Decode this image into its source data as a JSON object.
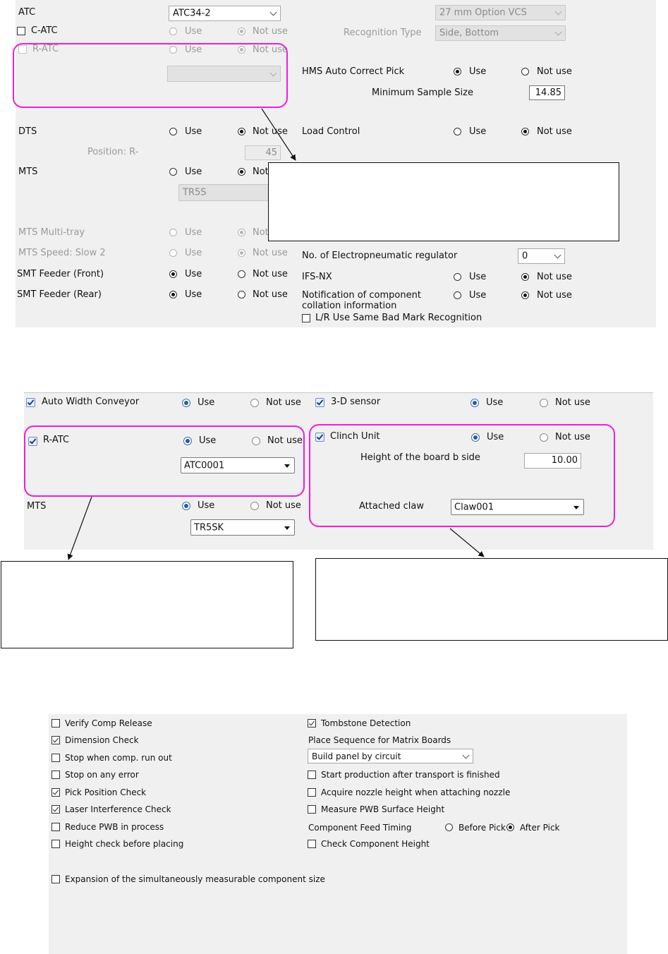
{
  "p1": {
    "atc": {
      "label": "ATC",
      "value": "ATC34-2"
    },
    "option_vcs": "27 mm Option VCS",
    "c_atc": {
      "label": "C-ATC",
      "use": "Use",
      "notuse": "Not use"
    },
    "recognition": {
      "label": "Recognition Type",
      "value": "Side, Bottom"
    },
    "r_atc": {
      "label": "R-ATC",
      "use": "Use",
      "notuse": "Not use"
    },
    "hms": {
      "label": "HMS Auto Correct Pick",
      "use": "Use",
      "notuse": "Not use"
    },
    "min_sample": {
      "label": "Minimum Sample Size",
      "value": "14.85"
    },
    "dts": {
      "label": "DTS",
      "use": "Use",
      "notuse": "Not use"
    },
    "load_control": {
      "label": "Load Control",
      "use": "Use",
      "notuse": "Not use"
    },
    "position": {
      "label": "Position: R-",
      "value": "45"
    },
    "mts": {
      "label": "MTS",
      "use": "Use",
      "notuse": "Not",
      "value": "TR5S"
    },
    "mts_multi": {
      "label": "MTS Multi-tray",
      "use": "Use",
      "notuse": "Not"
    },
    "mts_speed": {
      "label": "MTS Speed: Slow 2",
      "use": "Use",
      "notuse": "Not use"
    },
    "epr": {
      "label": "No. of Electropneumatic regulator",
      "value": "0"
    },
    "smt_front": {
      "label": "SMT Feeder (Front)",
      "use": "Use",
      "notuse": "Not use"
    },
    "ifs": {
      "label": "IFS-NX",
      "use": "Use",
      "notuse": "Not use"
    },
    "smt_rear": {
      "label": "SMT Feeder (Rear)",
      "use": "Use",
      "notuse": "Not use"
    },
    "notif": {
      "label1": "Notification of component",
      "label2": "collation information",
      "use": "Use",
      "notuse": "Not use"
    },
    "lr_bad": {
      "label": "L/R Use Same Bad Mark Recognition"
    }
  },
  "p2": {
    "awc": {
      "label": "Auto Width Conveyor",
      "use": "Use",
      "notuse": "Not use"
    },
    "sensor3d": {
      "label": "3-D sensor",
      "use": "Use",
      "notuse": "Not use"
    },
    "r_atc": {
      "label": "R-ATC",
      "use": "Use",
      "notuse": "Not use",
      "value": "ATC0001"
    },
    "clinch": {
      "label": "Clinch Unit",
      "use": "Use",
      "notuse": "Not use"
    },
    "board_b": {
      "label": "Height of the board b side",
      "value": "10.00"
    },
    "mts": {
      "label": "MTS",
      "use": "Use",
      "notuse": "Not use",
      "value": "TR5SK"
    },
    "claw": {
      "label": "Attached claw",
      "value": "Claw001"
    }
  },
  "p3": {
    "left": [
      {
        "label": "Verify Comp Release",
        "checked": false
      },
      {
        "label": "Dimension Check",
        "checked": true
      },
      {
        "label": "Stop when comp. run out",
        "checked": false
      },
      {
        "label": "Stop on any error",
        "checked": false
      },
      {
        "label": "Pick Position Check",
        "checked": true
      },
      {
        "label": "Laser Interference Check",
        "checked": true
      },
      {
        "label": "Reduce PWB in process",
        "checked": false
      },
      {
        "label": "Height check before placing",
        "checked": false
      }
    ],
    "tombstone": "Tombstone Detection",
    "place_seq": "Place Sequence for Matrix Boards",
    "place_seq_value": "Build panel by circuit",
    "start_prod": "Start production after transport is finished",
    "acquire_nozzle": "Acquire nozzle height when attaching nozzle",
    "measure_pwb": "Measure PWB Surface Height",
    "feed_timing": {
      "label": "Component Feed Timing",
      "before": "Before Pick",
      "after": "After Pick"
    },
    "check_height": "Check Component Height",
    "expansion": "Expansion of the simultaneously measurable component size"
  },
  "colors": {
    "highlight": "#ee1fd6",
    "panel": "#f0f0f0"
  }
}
